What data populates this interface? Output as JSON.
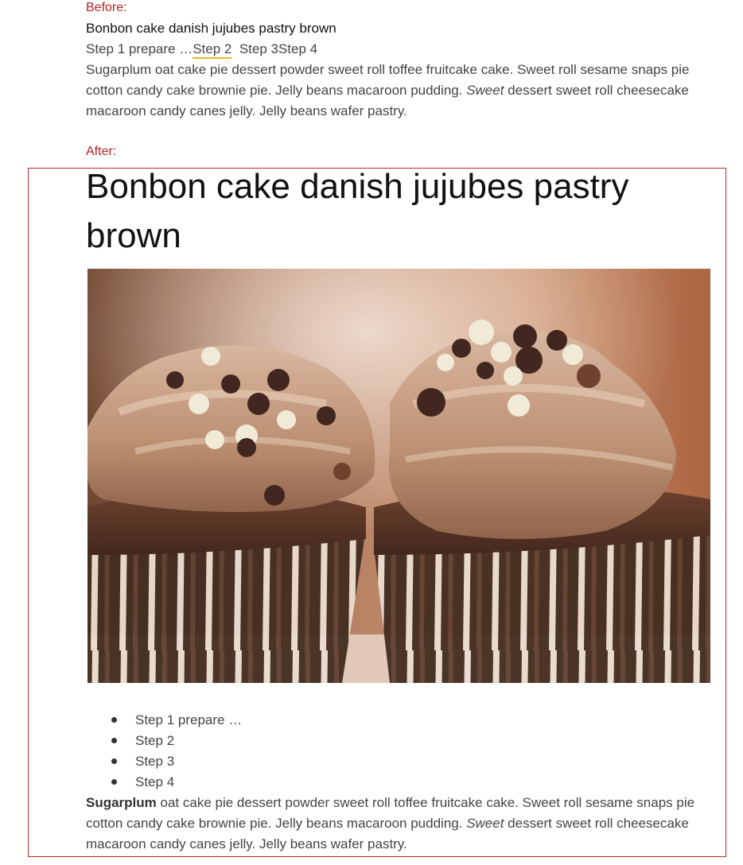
{
  "before": {
    "label": "Before:",
    "title": "Bonbon cake danish jujubes pastry brown",
    "steps": {
      "step1": "Step 1 prepare …",
      "step2": "Step 2",
      "step3": "Step 3",
      "step4": "Step 4"
    },
    "paragraph": {
      "part1": "Sugarplum oat cake pie dessert powder sweet roll toffee fruitcake cake. Sweet roll sesame snaps pie cotton candy cake brownie pie. Jelly beans macaroon pudding. ",
      "italic": "Sweet",
      "part2": " dessert sweet roll cheesecake macaroon candy canes jelly. Jelly beans wafer pastry."
    }
  },
  "after": {
    "label": "After:",
    "title": "Bonbon cake danish jujubes pastry brown",
    "steps": [
      "Step 1 prepare …",
      "Step 2",
      "Step 3",
      "Step 4"
    ],
    "paragraph": {
      "bold": "Sugarplum",
      "part1": " oat cake pie dessert powder sweet roll toffee fruitcake cake. Sweet roll sesame snaps pie cotton candy cake brownie pie. Jelly beans macaroon pudding. ",
      "italic": "Sweet",
      "part2": " dessert sweet roll cheesecake macaroon candy canes jelly. Jelly beans wafer pastry."
    }
  },
  "colors": {
    "label": "#b22222",
    "frame": "#c62828",
    "step_underline": "#e8b923"
  },
  "image": {
    "icon": "cupcakes-photo"
  }
}
